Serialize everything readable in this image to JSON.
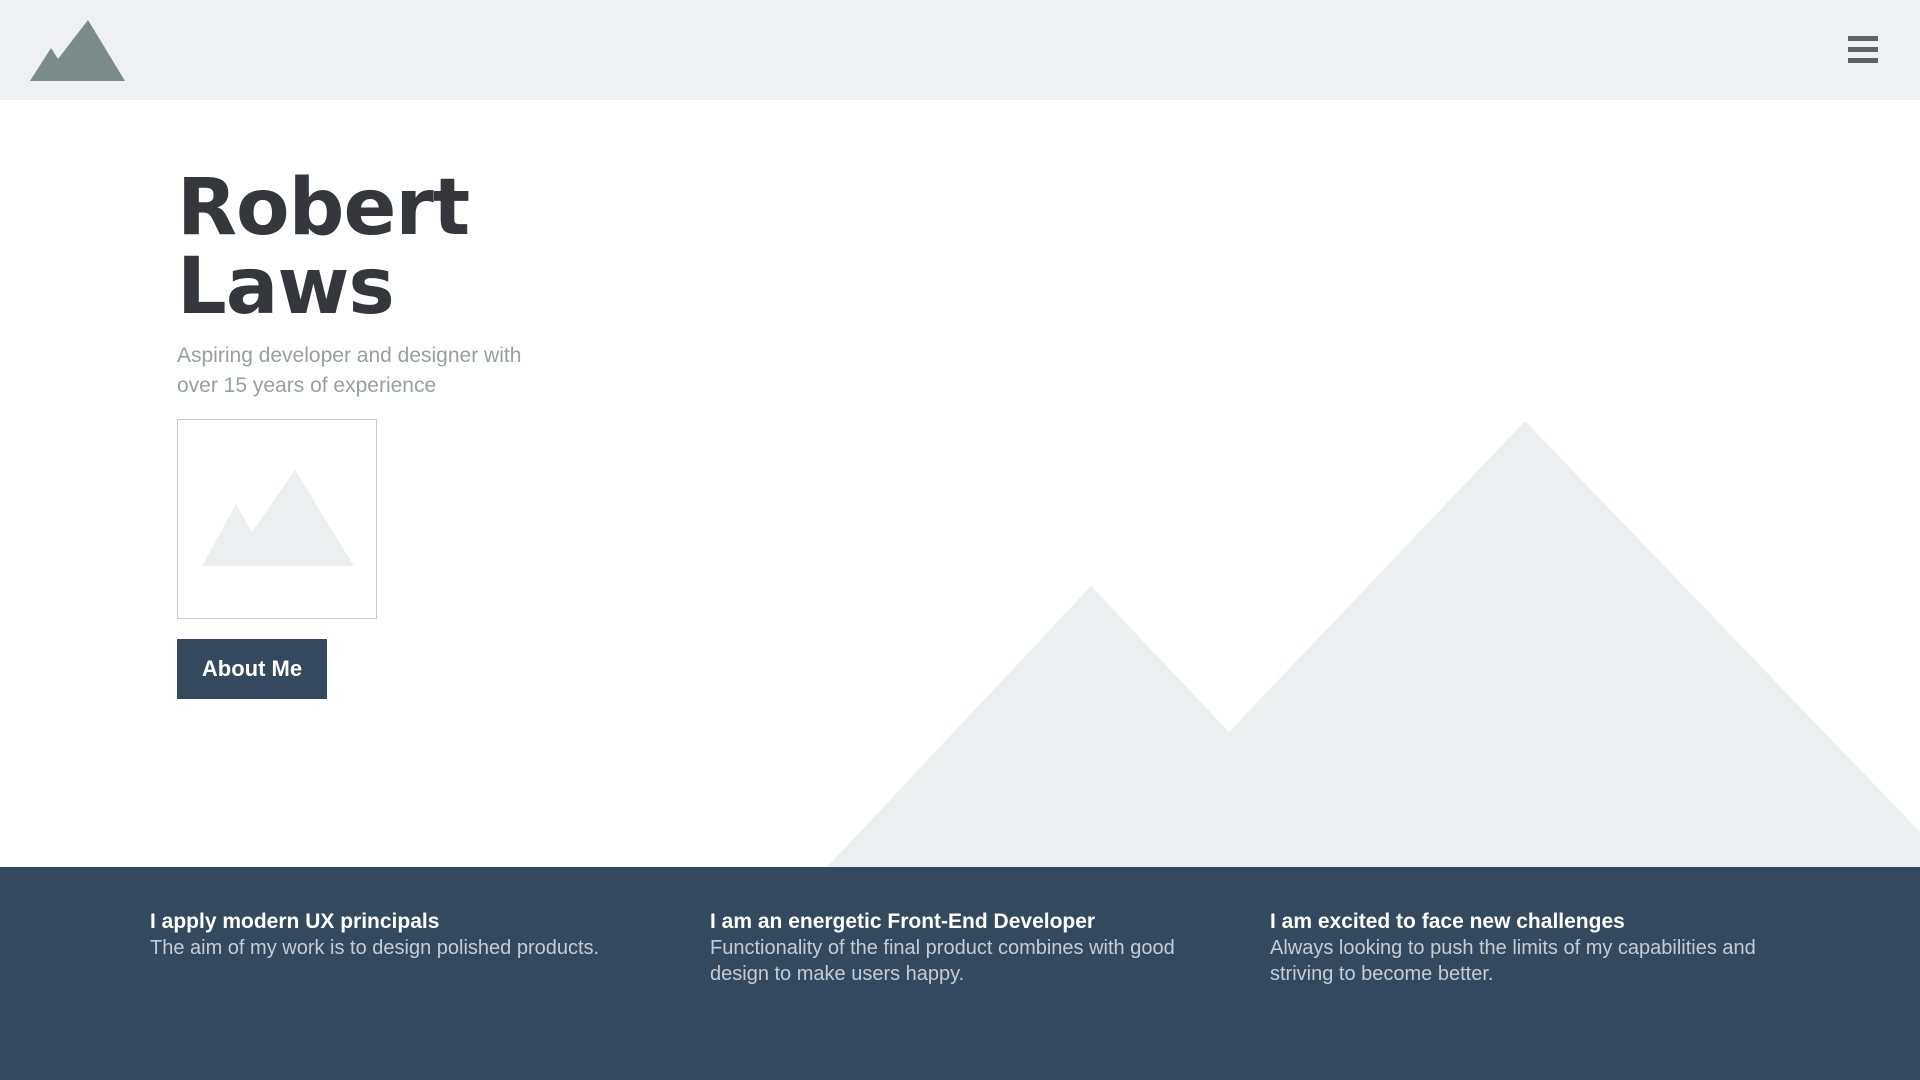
{
  "header": {
    "logo_icon": "mountain-logo-icon",
    "menu_icon": "hamburger-menu-icon"
  },
  "hero": {
    "name_line1": "Robert",
    "name_line2": "Laws",
    "tagline": "Aspiring developer and designer with over 15 years of experience",
    "photo_icon": "image-placeholder-icon",
    "about_button": "About Me",
    "background_icon": "mountains-illustration"
  },
  "features": [
    {
      "title": "I apply modern UX principals",
      "text": "The aim of my work is to design polished products."
    },
    {
      "title": "I am an energetic Front-End Developer",
      "text": "Functionality of the final product combines with good design to make users happy."
    },
    {
      "title": "I am excited to face new challenges",
      "text": "Always looking to push the limits of my capabilities and striving to become better."
    }
  ],
  "colors": {
    "header_bg": "#eff0f3",
    "logo": "#7b8b89",
    "text_dark": "#35373d",
    "text_muted": "#9a9ea3",
    "accent": "#34495e",
    "mountain_light": "#eceff0"
  }
}
